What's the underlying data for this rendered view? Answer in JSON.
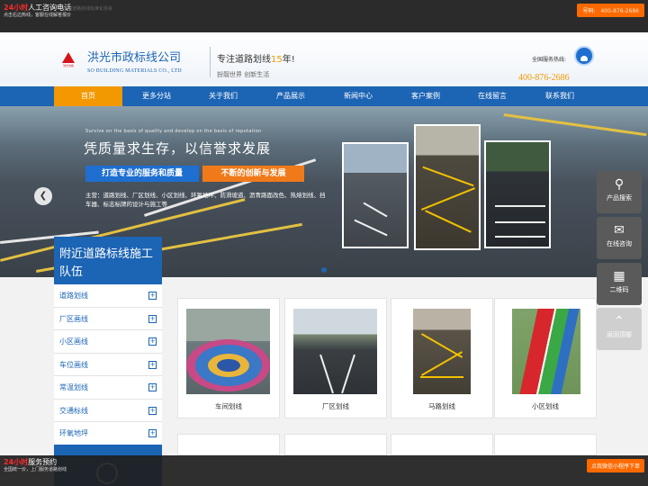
{
  "topbar": {
    "hot_prefix": "24小时",
    "hot_label": "人工咨询电话",
    "sub": "点击右边热线，客服在线解答报价",
    "faint": "中国道路划线标准化协会",
    "phone_label": "号码:",
    "phone_number": "400-876-2686"
  },
  "header": {
    "logo_text": "洪光市政",
    "company_cn": "洪光市政标线公司",
    "company_en": "SO BUILDING MATERIALS CO., LTD",
    "slogan_prefix": "专注道路划线",
    "slogan_years": "15",
    "slogan_suffix": "年!",
    "slogan2": "扮靓世界 创新生活",
    "hotline_label": "全国服务热线:",
    "hotline_number": "400-876-2686"
  },
  "nav": {
    "items": [
      "首页",
      "更多分站",
      "关于我们",
      "产品展示",
      "新闻中心",
      "客户案例",
      "在线留言",
      "联系我们"
    ],
    "active": "首页"
  },
  "banner": {
    "tag_en": "Survive on the basis of quality and develop on the basis of reputation",
    "title": "凭质量求生存，以信誉求发展",
    "pill_left": "打造专业的服务和质量",
    "pill_right": "不断的创新与发展",
    "desc": "主营：道路划线、厂区划线、小区划线、环氧地坪、防滑坡道、沥青路面改色、热熔划线、挡车器、标志标牌的设计与施工等"
  },
  "sidebar": {
    "title": "附近道路标线施工队伍",
    "items": [
      "道路划线",
      "厂区画线",
      "小区画线",
      "车位画线",
      "常温划线",
      "交通标线",
      "环氧地坪"
    ]
  },
  "products": [
    {
      "caption": "车间划线"
    },
    {
      "caption": "厂区划线"
    },
    {
      "caption": "马路划线"
    },
    {
      "caption": "小区划线"
    }
  ],
  "float": {
    "search": "产品搜索",
    "consult": "在线咨询",
    "qrcode": "二维码",
    "top": "返回顶部"
  },
  "bottombar": {
    "hot_prefix": "24小时",
    "hot_label": "服务预约",
    "sub": "全国统一价，上门服务道路划线",
    "mini": "点我微信小程序下单"
  },
  "colors": {
    "brand_blue": "#1c64b4",
    "accent_orange": "#f39800",
    "hot_red": "#ff2a2a"
  }
}
